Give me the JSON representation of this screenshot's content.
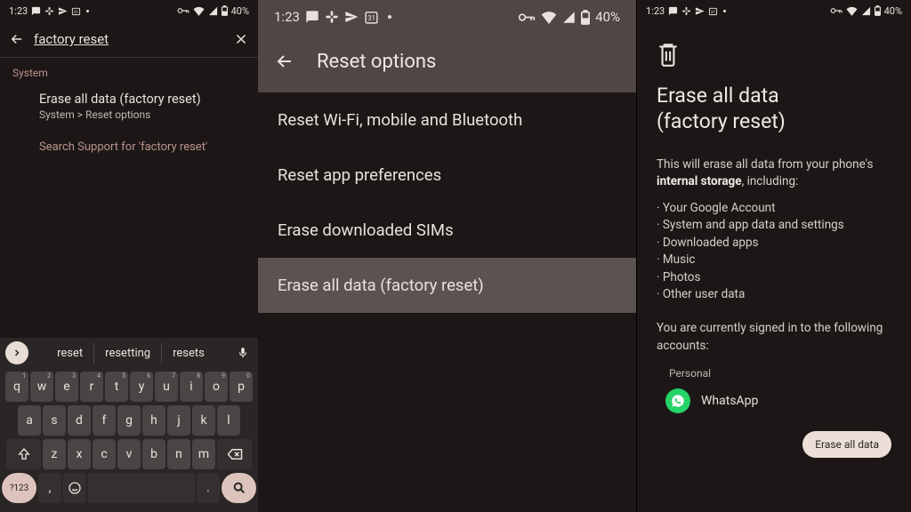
{
  "statusbar": {
    "time": "1:23",
    "battery": "40%"
  },
  "left": {
    "search_value": "factory reset",
    "category": "System",
    "result_title": "Erase all data (factory reset)",
    "result_path": "System > Reset options",
    "support": "Search Support for 'factory reset'",
    "suggestions": [
      "reset",
      "resetting",
      "resets"
    ],
    "keys_row1": [
      {
        "k": "q",
        "n": "1"
      },
      {
        "k": "w",
        "n": "2"
      },
      {
        "k": "e",
        "n": "3"
      },
      {
        "k": "r",
        "n": "4"
      },
      {
        "k": "t",
        "n": "5"
      },
      {
        "k": "y",
        "n": "6"
      },
      {
        "k": "u",
        "n": "7"
      },
      {
        "k": "i",
        "n": "8"
      },
      {
        "k": "o",
        "n": "9"
      },
      {
        "k": "p",
        "n": "0"
      }
    ],
    "keys_row2": [
      "a",
      "s",
      "d",
      "f",
      "g",
      "h",
      "j",
      "k",
      "l"
    ],
    "keys_row3": [
      "z",
      "x",
      "c",
      "v",
      "b",
      "n",
      "m"
    ],
    "key_symbols": "?123",
    "key_comma": ",",
    "key_period": "."
  },
  "mid": {
    "title": "Reset options",
    "items": [
      "Reset Wi-Fi, mobile and Bluetooth",
      "Reset app preferences",
      "Erase downloaded SIMs",
      "Erase all data (factory reset)"
    ]
  },
  "right": {
    "title_l1": "Erase all data",
    "title_l2": "(factory reset)",
    "desc_pre": "This will erase all data from your phone's ",
    "desc_bold": "internal storage",
    "desc_post": ", including:",
    "bullets": [
      "· Your Google Account",
      "· System and app data and settings",
      "· Downloaded apps",
      "· Music",
      "· Photos",
      "· Other user data"
    ],
    "signed_in": "You are currently signed in to the following accounts:",
    "account_label": "Personal",
    "account_name": "WhatsApp",
    "erase_btn": "Erase all data"
  }
}
